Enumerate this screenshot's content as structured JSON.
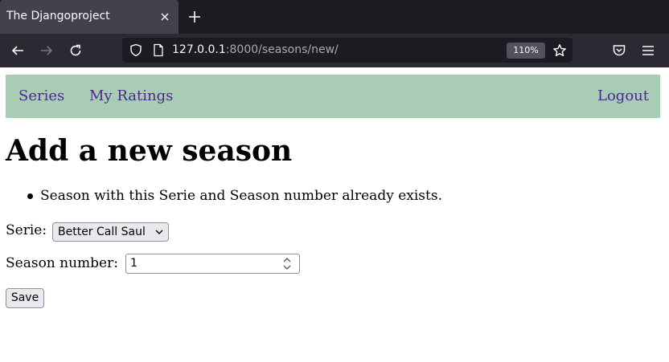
{
  "browser": {
    "tab_title": "The Djangoproject",
    "url_host": "127.0.0.1",
    "url_rest": ":8000/seasons/new/",
    "zoom": "110%"
  },
  "nav": {
    "series": "Series",
    "my_ratings": "My Ratings",
    "logout": "Logout"
  },
  "page": {
    "title": "Add a new season",
    "errors": [
      "Season with this Serie and Season number already exists."
    ]
  },
  "form": {
    "serie_label": "Serie:",
    "serie_value": "Better Call Saul",
    "season_label": "Season number:",
    "season_value": "1",
    "save_label": "Save"
  },
  "colors": {
    "nav_bg": "#a9ccb4",
    "link": "#4b2a8a"
  }
}
